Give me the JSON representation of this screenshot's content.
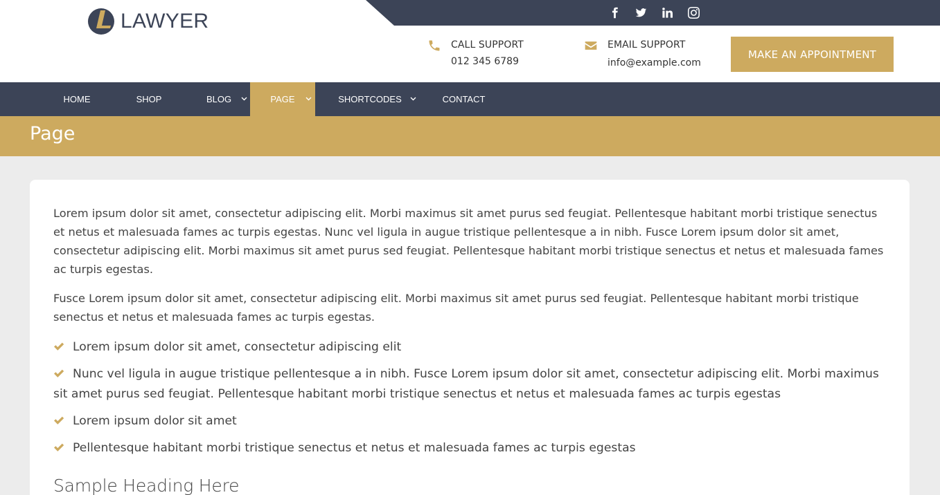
{
  "brand": {
    "name": "LAWYER",
    "accent": "#cdaa5f",
    "dark": "#3c4457"
  },
  "social": [
    {
      "icon": "facebook-icon"
    },
    {
      "icon": "twitter-icon"
    },
    {
      "icon": "linkedin-icon"
    },
    {
      "icon": "instagram-icon"
    }
  ],
  "contact": {
    "call_label": "CALL SUPPORT",
    "call_value": "012 345 6789",
    "email_label": "EMAIL SUPPORT",
    "email_value": "info@example.com"
  },
  "appointment_button": "MAKE AN APPOINTMENT",
  "nav": {
    "items": [
      {
        "label": "HOME",
        "dropdown": false,
        "active": false
      },
      {
        "label": "SHOP",
        "dropdown": false,
        "active": false
      },
      {
        "label": "BLOG",
        "dropdown": true,
        "active": false
      },
      {
        "label": "PAGE",
        "dropdown": true,
        "active": true
      },
      {
        "label": "SHORTCODES",
        "dropdown": true,
        "active": false
      },
      {
        "label": "CONTACT",
        "dropdown": false,
        "active": false
      }
    ]
  },
  "page_title": "Page",
  "content": {
    "paragraph1": "Lorem ipsum dolor sit amet, consectetur adipiscing elit. Morbi maximus sit amet purus sed feugiat. Pellentesque habitant morbi tristique senectus et netus et malesuada fames ac turpis egestas. Nunc vel ligula in augue tristique pellentesque a in nibh. Fusce Lorem ipsum dolor sit amet, consectetur adipiscing elit. Morbi maximus sit amet purus sed feugiat. Pellentesque habitant morbi tristique senectus et netus et malesuada fames ac turpis egestas.",
    "paragraph2": "Fusce Lorem ipsum dolor sit amet, consectetur adipiscing elit. Morbi maximus sit amet purus sed feugiat. Pellentesque habitant morbi tristique senectus et netus et malesuada fames ac turpis egestas.",
    "list": [
      "Lorem ipsum dolor sit amet, consectetur adipiscing elit",
      "Nunc vel ligula in augue tristique pellentesque a in nibh. Fusce Lorem ipsum dolor sit amet, consectetur adipiscing elit. Morbi maximus sit amet purus sed feugiat. Pellentesque habitant morbi tristique senectus et netus et malesuada fames ac turpis egestas",
      "Lorem ipsum dolor sit amet",
      "Pellentesque habitant morbi tristique senectus et netus et malesuada fames ac turpis egestas"
    ],
    "sample_heading": "Sample Heading Here"
  }
}
